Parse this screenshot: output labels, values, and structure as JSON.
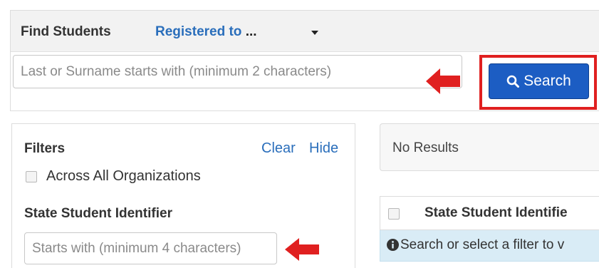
{
  "find_students": {
    "title": "Find Students",
    "registered_link": "Registered to",
    "registered_suffix": "...",
    "surname_placeholder": "Last or Surname starts with (minimum 2 characters)",
    "search_label": "Search"
  },
  "filters": {
    "title": "Filters",
    "clear_label": "Clear",
    "hide_label": "Hide",
    "across_label": "Across All Organizations",
    "across_checked": false,
    "ssid_title": "State Student Identifier",
    "ssid_placeholder": "Starts with (minimum 4 characters)"
  },
  "results": {
    "status_text": "No Results",
    "column_header": "State Student Identifie",
    "info_text": "Search or select a filter to v"
  },
  "annotations": {
    "arrow_color": "#e02020",
    "highlight_color": "#e02020"
  },
  "colors": {
    "link": "#2a6ebb",
    "search_button": "#1c5dc3",
    "info_row": "#d9ecf6"
  }
}
